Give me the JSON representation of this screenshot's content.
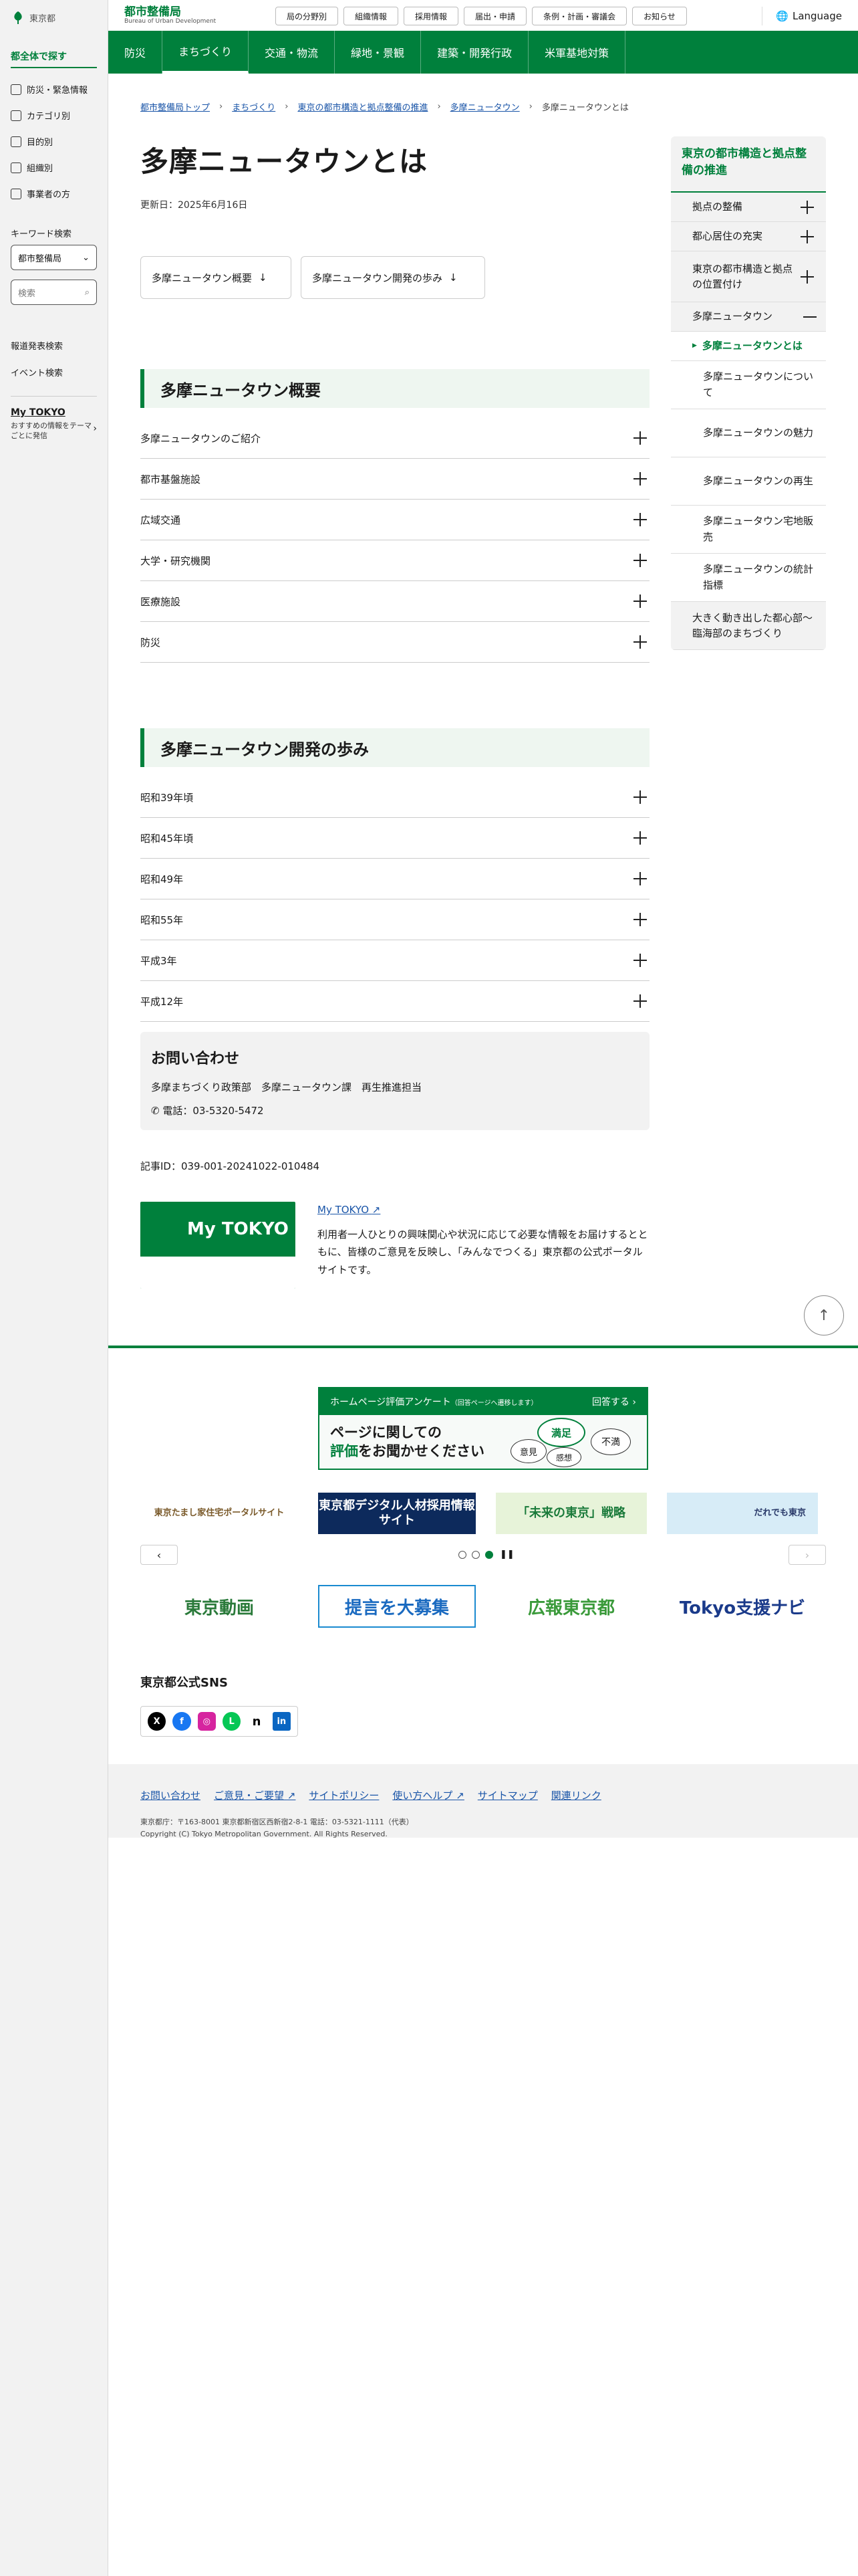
{
  "sidebar": {
    "logo": "東京都",
    "head": "都全体で探す",
    "nav": [
      "防災・緊急情報",
      "カテゴリ別",
      "目的別",
      "組織別",
      "事業者の方"
    ],
    "keyword_label": "キーワード検索",
    "select_value": "都市整備局",
    "search_placeholder": "検索",
    "links": [
      "報道発表検索",
      "イベント検索"
    ],
    "mytokyo_title": "My TOKYO",
    "mytokyo_desc": "おすすめの情報をテーマごとに発信"
  },
  "header": {
    "brand": "都市整備局",
    "brand_sub": "Bureau of Urban Development",
    "buttons": [
      "局の分野別",
      "組織情報",
      "採用情報",
      "届出・申請",
      "条例・計画・審議会",
      "お知らせ"
    ],
    "language": "Language"
  },
  "gnav": [
    "防災",
    "まちづくり",
    "交通・物流",
    "緑地・景観",
    "建築・開発行政",
    "米軍基地対策"
  ],
  "breadcrumb": [
    "都市整備局トップ",
    "まちづくり",
    "東京の都市構造と拠点整備の推進",
    "多摩ニュータウン",
    "多摩ニュータウンとは"
  ],
  "page": {
    "title": "多摩ニュータウンとは",
    "updated": "更新日：2025年6月16日",
    "anchors": [
      "多摩ニュータウン概要",
      "多摩ニュータウン開発の歩み"
    ],
    "sections": [
      {
        "title": "多摩ニュータウン概要",
        "items": [
          "多摩ニュータウンのご紹介",
          "都市基盤施設",
          "広域交通",
          "大学・研究機関",
          "医療施設",
          "防災"
        ]
      },
      {
        "title": "多摩ニュータウン開発の歩み",
        "items": [
          "昭和39年頃",
          "昭和45年頃",
          "昭和49年",
          "昭和55年",
          "平成3年",
          "平成12年"
        ]
      }
    ],
    "contact": {
      "title": "お問い合わせ",
      "dept": "多摩まちづくり政策部　多摩ニュータウン課　再生推進担当",
      "phone": "電話：03-5320-5472"
    },
    "article_id": "記事ID：039-001-20241022-010484",
    "mytokyo": {
      "logo": "My TOKYO",
      "link": "My TOKYO",
      "desc": "利用者一人ひとりの興味関心や状況に応じて必要な情報をお届けするとともに、皆様のご意見を反映し、「みんなでつくる」東京都の公式ポータルサイトです。"
    }
  },
  "local_nav": {
    "head": "東京の都市構造と拠点整備の推進",
    "items": [
      "拠点の整備",
      "都心居住の充実",
      "東京の都市構造と拠点の位置付け",
      "多摩ニュータウン"
    ],
    "subs": [
      "多摩ニュータウンとは",
      "多摩ニュータウンについて",
      "多摩ニュータウンの魅力",
      "多摩ニュータウンの再生",
      "多摩ニュータウン宅地販売",
      "多摩ニュータウンの統計指標"
    ],
    "last": "大きく動き出した都心部〜臨海部のまちづくり"
  },
  "footer": {
    "survey_bar": "ホームページ評価アンケート",
    "survey_bar_small": "（回答ページへ遷移します）",
    "survey_answer": "回答する",
    "survey_msg1": "ページに関しての",
    "survey_msg2": "評価",
    "survey_msg3": "をお聞かせください",
    "survey_words": [
      "満足",
      "意見",
      "不満",
      "感想"
    ],
    "banners": [
      "東京たまし家住宅ポータルサイト",
      "東京都デジタル人材採用情報サイト",
      "「未来の東京」戦略",
      "だれでも東京"
    ],
    "banners2": [
      "東京動画",
      "提言を大募集",
      "広報東京都",
      "Tokyo支援ナビ"
    ],
    "sns_title": "東京都公式SNS",
    "links": [
      "お問い合わせ",
      "ご意見・ご要望",
      "サイトポリシー",
      "使い方ヘルプ",
      "サイトマップ",
      "関連リンク"
    ],
    "address": "東京都庁：〒163-8001 東京都新宿区西新宿2-8-1 電話：03-5321-1111（代表）",
    "copyright": "Copyright (C) Tokyo Metropolitan Government. All Rights Reserved."
  },
  "colors": {
    "brand": "#00803c",
    "link": "#1a55a8"
  }
}
